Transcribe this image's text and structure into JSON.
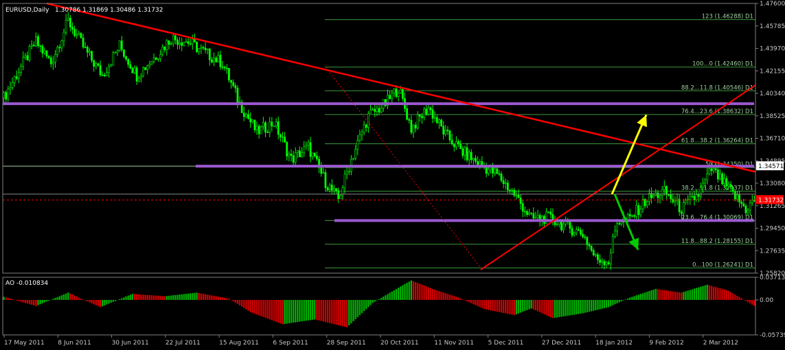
{
  "chart_data": [
    {
      "type": "candlestick",
      "title": "EURUSD,Daily",
      "ohlc_readout": "1.30786 1.31869 1.30486 1.31732",
      "ylim": [
        1.2582,
        1.476
      ],
      "y_ticks": [
        "1.47600",
        "1.45785",
        "1.43970",
        "1.42155",
        "1.40340",
        "1.38525",
        "1.36710",
        "1.34895",
        "1.33080",
        "1.31265",
        "1.29450",
        "1.27635",
        "1.25820"
      ],
      "current_price_label": "1.31732",
      "highlight_price_label": "1.34571",
      "x_tick_labels": [
        "17 May 2011",
        "8 Jun 2011",
        "30 Jun 2011",
        "22 Jul 2011",
        "15 Aug 2011",
        "6 Sep 2011",
        "28 Sep 2011",
        "20 Oct 2011",
        "11 Nov 2011",
        "5 Dec 2011",
        "27 Dec 2011",
        "18 Jan 2012",
        "9 Feb 2012",
        "2 Mar 2012"
      ],
      "close_path": [
        [
          0,
          1.4
        ],
        [
          8,
          1.425
        ],
        [
          15,
          1.445
        ],
        [
          22,
          1.428
        ],
        [
          30,
          1.462
        ],
        [
          38,
          1.438
        ],
        [
          46,
          1.418
        ],
        [
          54,
          1.442
        ],
        [
          62,
          1.418
        ],
        [
          70,
          1.432
        ],
        [
          78,
          1.448
        ],
        [
          86,
          1.445
        ],
        [
          94,
          1.436
        ],
        [
          102,
          1.428
        ],
        [
          110,
          1.395
        ],
        [
          118,
          1.372
        ],
        [
          126,
          1.38
        ],
        [
          134,
          1.35
        ],
        [
          142,
          1.36
        ],
        [
          150,
          1.332
        ],
        [
          156,
          1.318
        ],
        [
          162,
          1.35
        ],
        [
          170,
          1.385
        ],
        [
          178,
          1.395
        ],
        [
          184,
          1.408
        ],
        [
          190,
          1.375
        ],
        [
          198,
          1.392
        ],
        [
          206,
          1.37
        ],
        [
          214,
          1.356
        ],
        [
          222,
          1.346
        ],
        [
          230,
          1.338
        ],
        [
          238,
          1.322
        ],
        [
          246,
          1.302
        ],
        [
          254,
          1.303
        ],
        [
          262,
          1.296
        ],
        [
          270,
          1.29
        ],
        [
          276,
          1.27
        ],
        [
          282,
          1.268
        ],
        [
          286,
          1.3
        ],
        [
          292,
          1.302
        ],
        [
          300,
          1.318
        ],
        [
          308,
          1.324
        ],
        [
          316,
          1.31
        ],
        [
          324,
          1.322
        ],
        [
          330,
          1.342
        ],
        [
          338,
          1.326
        ],
        [
          346,
          1.31
        ],
        [
          350,
          1.317
        ]
      ],
      "fibonacci_levels": [
        {
          "label": "123 (1.46288) D1",
          "value": 1.46288
        },
        {
          "label": "100...0 (1.42460) D1",
          "value": 1.4246
        },
        {
          "label": "88.2...11.8 (1.40546) D1",
          "value": 1.40546
        },
        {
          "label": "76.4...23.6 (1.38632) D1",
          "value": 1.38632
        },
        {
          "label": "61.8...38.2 (1.36264) D1",
          "value": 1.36264
        },
        {
          "label": "50 (1.34350) D1",
          "value": 1.3435
        },
        {
          "label": "38.2...61.8 (1.32437) D1",
          "value": 1.32437
        },
        {
          "label": "23.6...76.4 (1.30069) D1",
          "value": 1.30069
        },
        {
          "label": "11.8...88.2 (1.28155) D1",
          "value": 1.28155
        },
        {
          "label": "0...100 (1.26241) D1",
          "value": 1.26241
        }
      ],
      "horizontal_levels": [
        1.395,
        1.3446,
        1.3007
      ],
      "colors": {
        "candle": "#00ff00",
        "fib": "#3c9a3c",
        "trend": "#ff0000",
        "level": "#9b59d0",
        "up_arrow": "#ffff00",
        "down_arrow": "#00cc00",
        "price_line": "#ff0000"
      }
    },
    {
      "type": "bar",
      "title": "AO -0.010834",
      "ylim": [
        -0.05739,
        0.03713
      ],
      "y_ticks": [
        "0.037137",
        "0.00",
        "-0.05739"
      ],
      "values_path": [
        [
          0,
          0.005
        ],
        [
          15,
          -0.01
        ],
        [
          30,
          0.012
        ],
        [
          45,
          -0.012
        ],
        [
          60,
          0.01
        ],
        [
          75,
          0.006
        ],
        [
          90,
          0.012
        ],
        [
          105,
          0.002
        ],
        [
          115,
          -0.02
        ],
        [
          130,
          -0.04
        ],
        [
          145,
          -0.032
        ],
        [
          160,
          -0.045
        ],
        [
          172,
          -0.005
        ],
        [
          184,
          0.02
        ],
        [
          190,
          0.032
        ],
        [
          200,
          0.018
        ],
        [
          212,
          0.004
        ],
        [
          224,
          -0.015
        ],
        [
          238,
          -0.025
        ],
        [
          246,
          -0.014
        ],
        [
          256,
          -0.03
        ],
        [
          270,
          -0.022
        ],
        [
          282,
          -0.012
        ],
        [
          292,
          0.004
        ],
        [
          304,
          0.018
        ],
        [
          316,
          0.012
        ],
        [
          328,
          0.025
        ],
        [
          338,
          0.015
        ],
        [
          350,
          -0.01
        ]
      ],
      "colors": {
        "up": "#00b000",
        "down": "#d00000"
      }
    }
  ]
}
